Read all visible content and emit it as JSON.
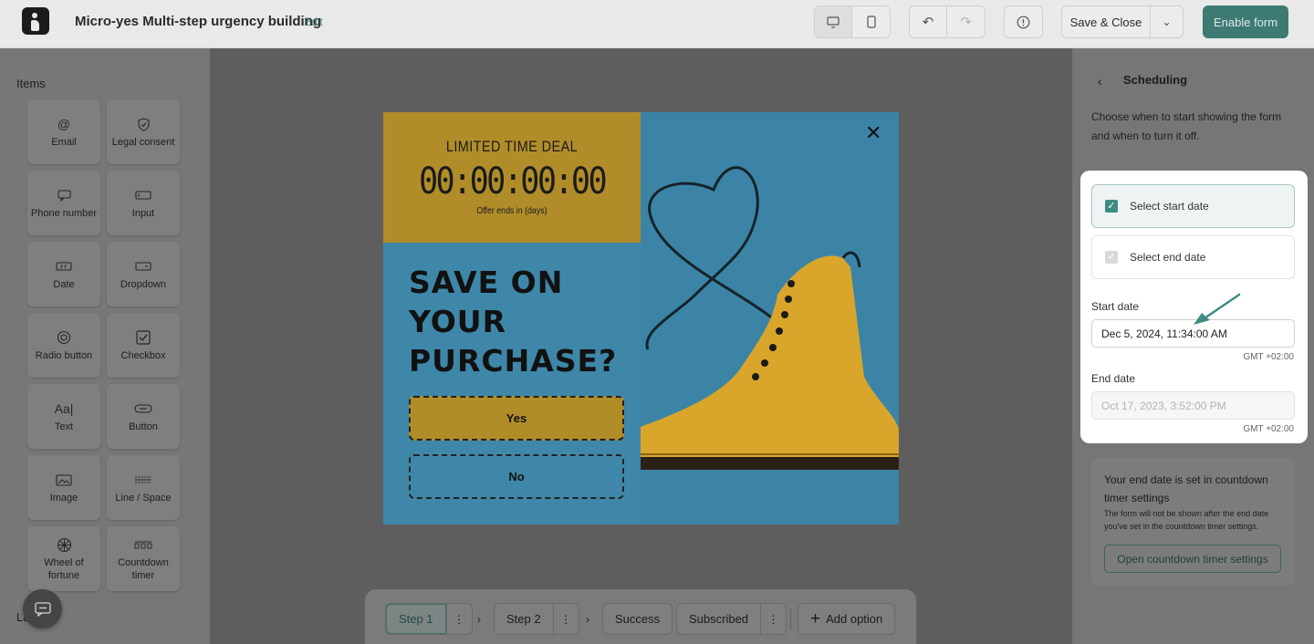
{
  "header": {
    "title": "Micro-yes Multi-step urgency building",
    "edit_label": "Edit",
    "save_close_label": "Save & Close",
    "enable_label": "Enable form",
    "accent_color": "#3e7a74"
  },
  "sidebar": {
    "items_title": "Items",
    "layers_title": "La",
    "items": [
      {
        "label": "Email",
        "icon": "at-icon"
      },
      {
        "label": "Legal consent",
        "icon": "shield-icon"
      },
      {
        "label": "Phone number",
        "icon": "chat-icon"
      },
      {
        "label": "Input",
        "icon": "input-icon"
      },
      {
        "label": "Date",
        "icon": "date-icon"
      },
      {
        "label": "Dropdown",
        "icon": "dropdown-icon"
      },
      {
        "label": "Radio button",
        "icon": "radio-icon"
      },
      {
        "label": "Checkbox",
        "icon": "checkbox-icon"
      },
      {
        "label": "Text",
        "icon": "text-icon"
      },
      {
        "label": "Button",
        "icon": "button-icon"
      },
      {
        "label": "Image",
        "icon": "image-icon"
      },
      {
        "label": "Line / Space",
        "icon": "line-icon"
      },
      {
        "label": "Wheel of fortune",
        "icon": "wheel-icon"
      },
      {
        "label": "Countdown timer",
        "icon": "countdown-icon"
      }
    ]
  },
  "popup": {
    "deal_heading": "LIMITED TIME DEAL",
    "timer": "00:00:00:00",
    "timer_sub": "Offer ends in (days)",
    "headline_lines": [
      "SAVE ON",
      "YOUR",
      "PURCHASE?"
    ],
    "yes_label": "Yes",
    "no_label": "No",
    "deal_color": "#b18d2a",
    "blue_color": "#3e87a8"
  },
  "steps": {
    "step1": "Step 1",
    "step2": "Step 2",
    "success": "Success",
    "subscribed": "Subscribed",
    "add_option": "Add option"
  },
  "scheduling": {
    "title": "Scheduling",
    "description": "Choose when to start showing the form and when to turn it off.",
    "select_start": "Select start date",
    "select_end": "Select end date",
    "start_label": "Start date",
    "start_value": "Dec 5, 2024, 11:34:00 AM",
    "start_tz": "GMT +02:00",
    "end_label": "End date",
    "end_value": "Oct 17, 2023, 3:52:00 PM",
    "end_tz": "GMT +02:00",
    "info_title": "Your end date is set in countdown timer settings",
    "info_body": "The form will not be shown after the end date you've set in the countdown timer settings.",
    "info_button": "Open countdown timer settings"
  }
}
